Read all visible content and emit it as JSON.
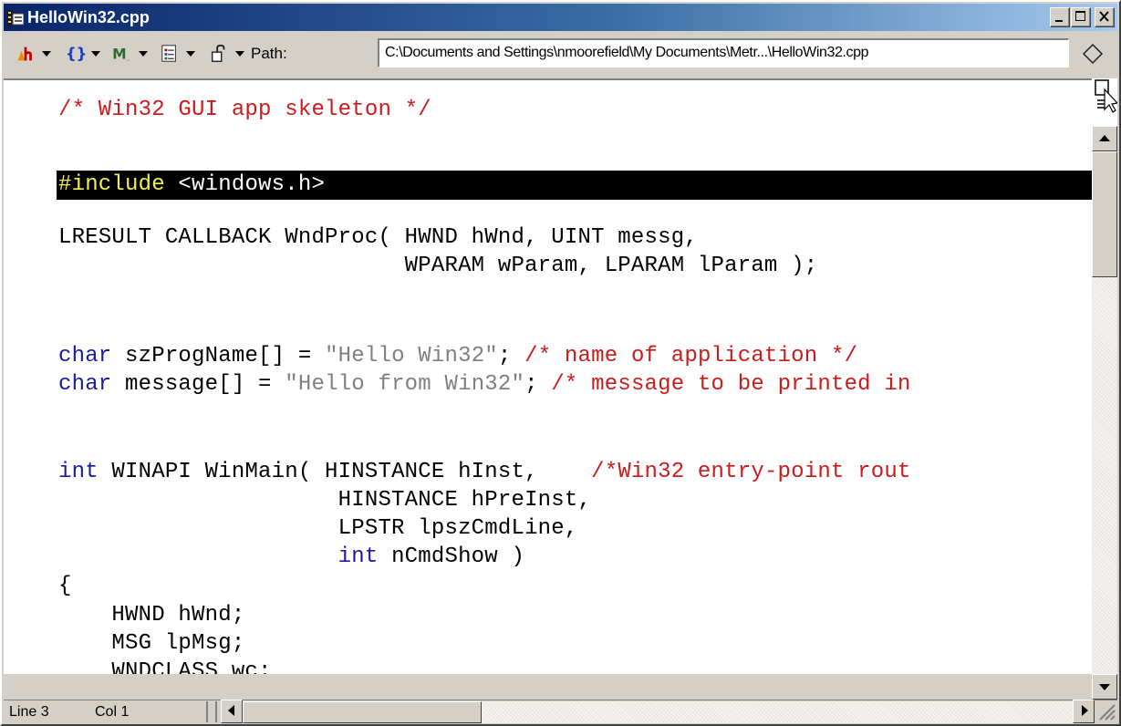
{
  "window": {
    "title": "HelloWin32.cpp",
    "active_caption_color": "#0a246a"
  },
  "toolbar": {
    "icons": [
      "function-icon",
      "braces-icon",
      "bookmark-m-icon",
      "list-icon",
      "lock-icon"
    ],
    "path_label": "Path:",
    "path_value": "C:\\Documents and Settings\\nmoorefield\\My Documents\\Metr...\\HelloWin32.cpp",
    "path_browse_icon": "diamond-icon"
  },
  "editor": {
    "highlight_color": "#000000",
    "keyword_color": "#1a1aa6",
    "comment_color": "#cc1b1b",
    "string_color": "#808080",
    "lines": {
      "l1": "/* Win32 GUI app skeleton */",
      "l3_pp": "#include",
      "l3_rest": " <windows.h>",
      "l5": "LRESULT CALLBACK WndProc( HWND hWnd, UINT messg,",
      "l6": "                          WPARAM wParam, LPARAM lParam );",
      "l9_kw": "char",
      "l9_a": " szProgName[] = ",
      "l9_str": "\"Hello Win32\"",
      "l9_b": "; ",
      "l9_cm": "/* name of application */",
      "l10_kw": "char",
      "l10_a": " message[] = ",
      "l10_str": "\"Hello from Win32\"",
      "l10_b": "; ",
      "l10_cm": "/* message to be printed in",
      "l13_kw": "int",
      "l13_a": " WINAPI WinMain( HINSTANCE hInst,    ",
      "l13_cm": "/*Win32 entry-point rout",
      "l14": "                     HINSTANCE hPreInst,",
      "l15": "                     LPSTR lpszCmdLine,",
      "l16_pad": "                     ",
      "l16_kw": "int",
      "l16_rest": " nCmdShow )",
      "l17": "{",
      "l18": "    HWND hWnd;",
      "l19": "    MSG lpMsg;",
      "l20": "    WNDCLASS wc;"
    }
  },
  "status": {
    "line": "Line 3",
    "col": "Col 1"
  }
}
